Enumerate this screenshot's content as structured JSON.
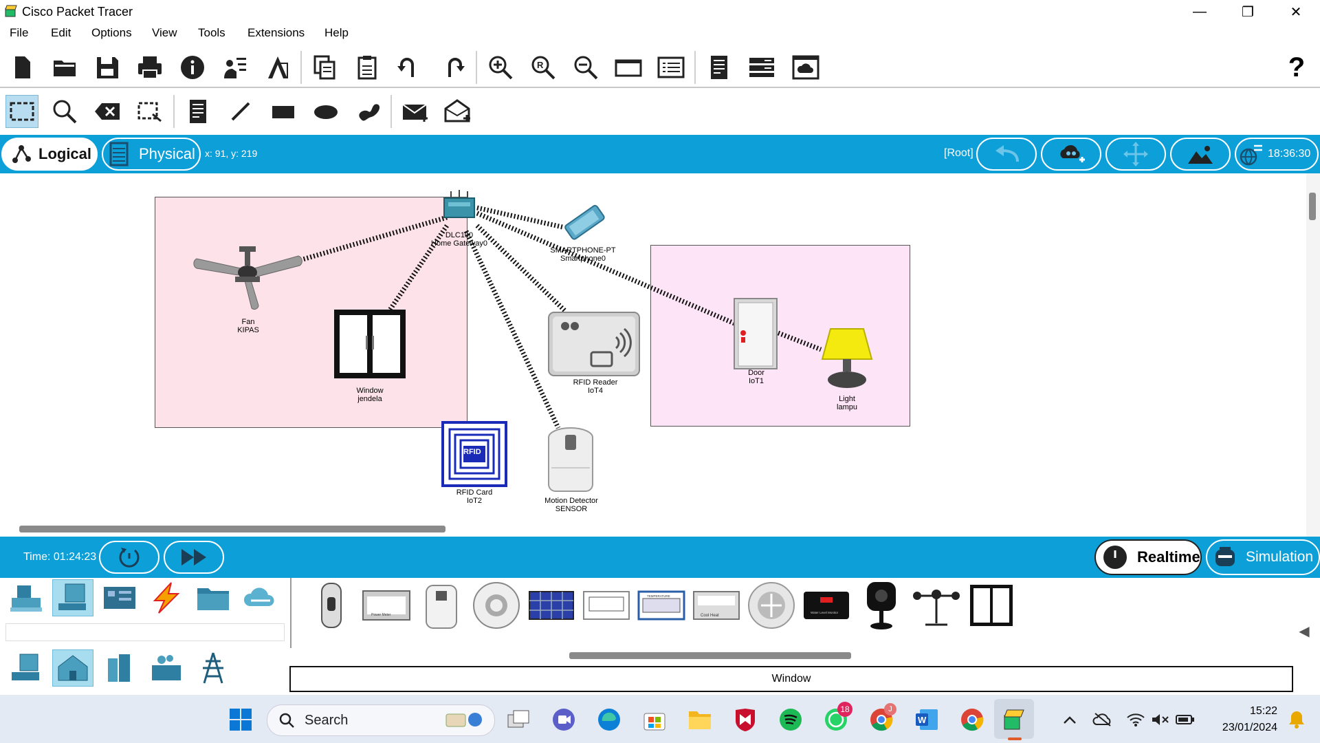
{
  "window": {
    "title": "Cisco Packet Tracer"
  },
  "menu": [
    "File",
    "Edit",
    "Options",
    "View",
    "Tools",
    "Extensions",
    "Help"
  ],
  "toolbar_main": [
    "new-file",
    "open-folder",
    "save",
    "print",
    "info",
    "network-wizard",
    "activity-wizard",
    "copy",
    "paste",
    "undo",
    "redo",
    "zoom-in",
    "zoom-reset",
    "zoom-out",
    "window-view",
    "custom-device-dialog",
    "notes",
    "server-rack",
    "cloud-image"
  ],
  "help_symbol": "?",
  "toolbar_draw": [
    "select",
    "inspect",
    "delete",
    "resize",
    "note",
    "line",
    "rectangle",
    "ellipse",
    "freeform",
    "add-simple-pdu",
    "add-complex-pdu"
  ],
  "modebar": {
    "logical": "Logical",
    "physical": "Physical",
    "coords": "x: 91, y: 219",
    "root": "[Root]",
    "clock": "18:36:30"
  },
  "devices": {
    "gateway": {
      "name": "DLC100",
      "label": "Home Gateway0"
    },
    "phone": {
      "name": "SMARTPHONE-PT",
      "label": "Smartphone0"
    },
    "fan": {
      "name": "Fan",
      "label": "KIPAS"
    },
    "window": {
      "name": "Window",
      "label": "jendela"
    },
    "rfid_reader": {
      "name": "RFID Reader",
      "label": "IoT4"
    },
    "rfid_card": {
      "name": "RFID Card",
      "label": "IoT2",
      "badge": "RFID"
    },
    "motion": {
      "name": "Motion Detector",
      "label": "SENSOR"
    },
    "door": {
      "name": "Door",
      "label": "IoT1"
    },
    "light": {
      "name": "Light",
      "label": "lampu"
    }
  },
  "status": {
    "time": "Time: 01:24:23",
    "realtime": "Realtime",
    "simulation": "Simulation"
  },
  "device_panel": {
    "selected_name": "Window",
    "items": [
      "sensor-device",
      "power-meter",
      "humidifier",
      "smoke-detector",
      "solar-panel",
      "lcd",
      "temperature-monitor",
      "thermostat",
      "fan-speed",
      "water-level-monitor",
      "webcam",
      "wind-detector",
      "window"
    ],
    "power_meter_text": "Power Meter",
    "thermostat_text": "Cool   Heat",
    "temperature_text": "TEMPERATURE",
    "water_level_text": "Water Level Monitor"
  },
  "taskbar": {
    "search": "Search",
    "time": "15:22",
    "date": "23/01/2024",
    "whatsapp_badge": "18",
    "chrome_badge": "J"
  },
  "colors": {
    "accent": "#0d9fd8",
    "zone_left": "#fde2ea",
    "zone_right": "#fde4f6"
  }
}
